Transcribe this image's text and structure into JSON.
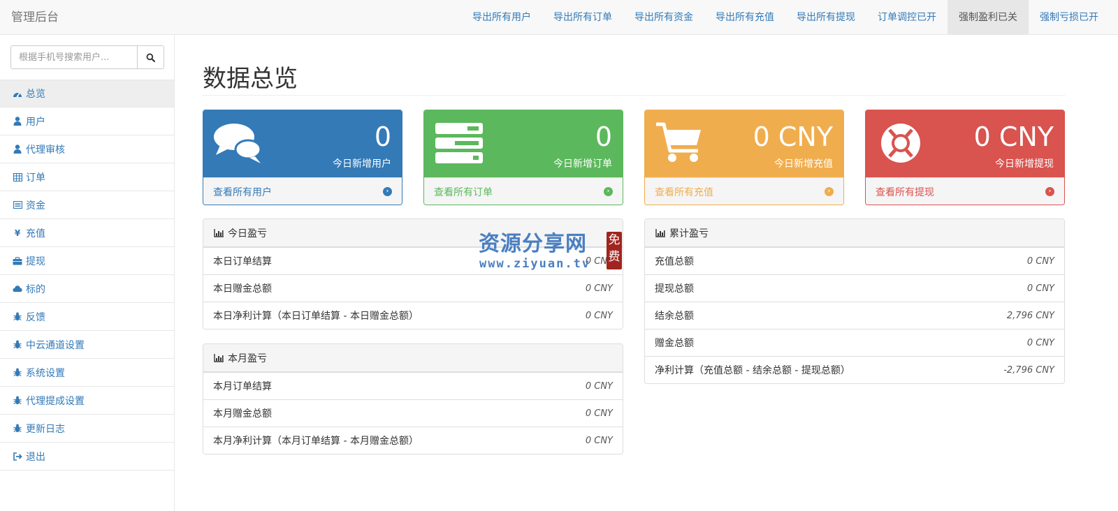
{
  "navbar": {
    "brand": "管理后台",
    "links": [
      {
        "label": "导出所有用户"
      },
      {
        "label": "导出所有订单"
      },
      {
        "label": "导出所有资金"
      },
      {
        "label": "导出所有充值"
      },
      {
        "label": "导出所有提现"
      },
      {
        "label": "订单调控已开"
      },
      {
        "label": "强制盈利已关",
        "active": true
      },
      {
        "label": "强制亏损已开"
      }
    ]
  },
  "sidebar": {
    "search": {
      "placeholder": "根据手机号搜索用户...",
      "value": ""
    },
    "items": [
      {
        "label": "总览",
        "icon": "dashboard-icon",
        "active": true
      },
      {
        "label": "用户",
        "icon": "user-icon"
      },
      {
        "label": "代理审核",
        "icon": "user-icon"
      },
      {
        "label": "订单",
        "icon": "table-icon"
      },
      {
        "label": "资金",
        "icon": "list-icon"
      },
      {
        "label": "充值",
        "icon": "yen-icon"
      },
      {
        "label": "提现",
        "icon": "briefcase-icon"
      },
      {
        "label": "标的",
        "icon": "cloud-icon"
      },
      {
        "label": "反馈",
        "icon": "bug-icon"
      },
      {
        "label": "中云通道设置",
        "icon": "bug-icon"
      },
      {
        "label": "系统设置",
        "icon": "bug-icon"
      },
      {
        "label": "代理提成设置",
        "icon": "bug-icon"
      },
      {
        "label": "更新日志",
        "icon": "bug-icon"
      },
      {
        "label": "退出",
        "icon": "sign-out-icon"
      }
    ]
  },
  "main": {
    "title": "数据总览",
    "cards": [
      {
        "value": "0",
        "label": "今日新增用户",
        "link": "查看所有用户",
        "icon": "comments-icon",
        "color": "#337ab7"
      },
      {
        "value": "0",
        "label": "今日新增订单",
        "link": "查看所有订单",
        "icon": "tasks-icon",
        "color": "#5cb85c"
      },
      {
        "value": "0 CNY",
        "label": "今日新增充值",
        "link": "查看所有充值",
        "icon": "shopping-cart-icon",
        "color": "#f0ad4e"
      },
      {
        "value": "0 CNY",
        "label": "今日新增提现",
        "link": "查看所有提现",
        "icon": "life-ring-icon",
        "color": "#d9534f"
      }
    ],
    "today_panel": {
      "title": "今日盈亏",
      "rows": [
        {
          "label": "本日订单结算",
          "value": "0 CNY"
        },
        {
          "label": "本日赠金总额",
          "value": "0 CNY"
        },
        {
          "label": "本日净利计算（本日订单结算 - 本日赠金总额）",
          "value": "0 CNY"
        }
      ]
    },
    "month_panel": {
      "title": "本月盈亏",
      "rows": [
        {
          "label": "本月订单结算",
          "value": "0 CNY"
        },
        {
          "label": "本月赠金总额",
          "value": "0 CNY"
        },
        {
          "label": "本月净利计算（本月订单结算 - 本月赠金总额）",
          "value": "0 CNY"
        }
      ]
    },
    "total_panel": {
      "title": "累计盈亏",
      "rows": [
        {
          "label": "充值总额",
          "value": "0 CNY"
        },
        {
          "label": "提现总额",
          "value": "0 CNY"
        },
        {
          "label": "结余总额",
          "value": "2,796 CNY"
        },
        {
          "label": "赠金总额",
          "value": "0 CNY"
        },
        {
          "label": "净利计算（充值总额 - 结余总额 - 提现总额）",
          "value": "-2,796 CNY"
        }
      ]
    }
  },
  "watermark": {
    "title": "资源分享网",
    "url": "www.ziyuan.tv",
    "stamp": "免费"
  }
}
